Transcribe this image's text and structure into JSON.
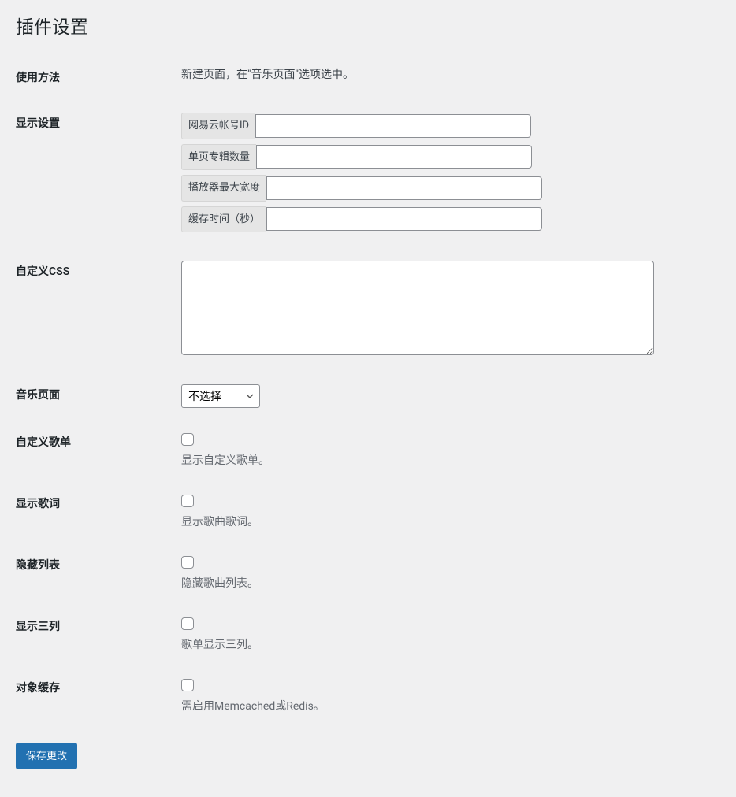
{
  "page": {
    "title": "插件设置"
  },
  "rows": {
    "usage": {
      "label": "使用方法",
      "text": "新建页面，在\"音乐页面\"选项选中。"
    },
    "display": {
      "label": "显示设置",
      "fields": {
        "netease_id": {
          "label": "网易云帐号ID",
          "value": ""
        },
        "album_count": {
          "label": "单页专辑数量",
          "value": ""
        },
        "max_width": {
          "label": "播放器最大宽度",
          "value": ""
        },
        "cache_time": {
          "label": "缓存时间（秒）",
          "value": ""
        }
      }
    },
    "custom_css": {
      "label": "自定义CSS",
      "value": ""
    },
    "music_page": {
      "label": "音乐页面",
      "selected": "不选择"
    },
    "custom_playlist": {
      "label": "自定义歌单",
      "description": "显示自定义歌单。"
    },
    "show_lyrics": {
      "label": "显示歌词",
      "description": "显示歌曲歌词。"
    },
    "hide_list": {
      "label": "隐藏列表",
      "description": "隐藏歌曲列表。"
    },
    "three_columns": {
      "label": "显示三列",
      "description": "歌单显示三列。"
    },
    "object_cache": {
      "label": "对象缓存",
      "description": "需启用Memcached或Redis。"
    }
  },
  "submit": {
    "label": "保存更改"
  }
}
